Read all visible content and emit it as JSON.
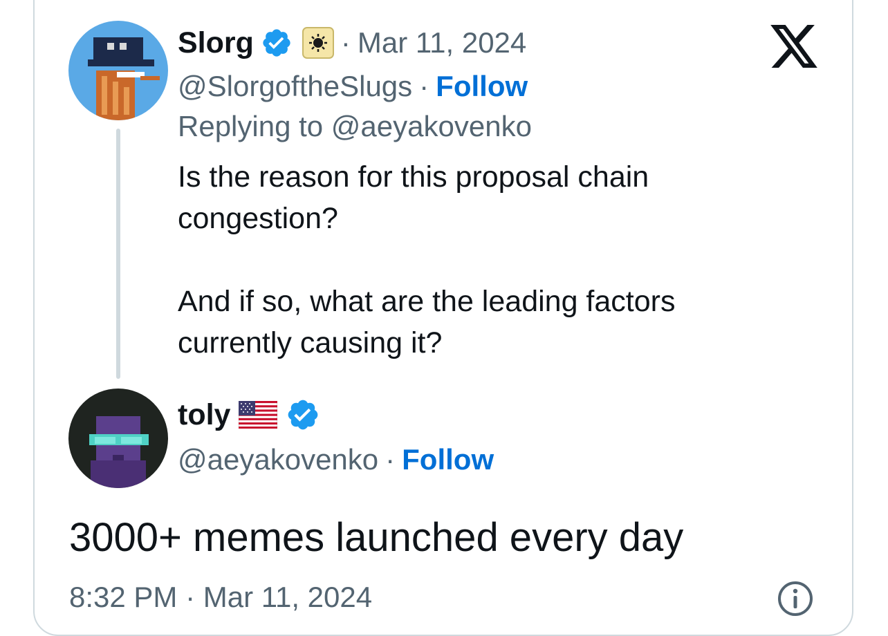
{
  "card": {
    "x_logo_icon": "x-logo-icon",
    "info_icon": "info-icon"
  },
  "reply_tweet": {
    "display_name": "Slorg",
    "verified_icon": "verified-badge-icon",
    "affiliate_icon": "affiliate-badge-icon",
    "separator": "·",
    "date": "Mar 11, 2024",
    "handle": "@SlorgoftheSlugs",
    "follow_label": "Follow",
    "replying_to": "Replying to @aeyakovenko",
    "text_line_1": "Is the reason for this proposal chain",
    "text_line_2": "congestion?",
    "text_line_3": "And if so, what are the leading factors",
    "text_line_4": "currently causing it?"
  },
  "main_tweet": {
    "display_name": "toly",
    "flag_icon": "us-flag-icon",
    "verified_icon": "verified-badge-icon",
    "handle": "@aeyakovenko",
    "separator": "·",
    "follow_label": "Follow",
    "text": "3000+ memes launched every day",
    "timestamp": "8:32 PM · Mar 11, 2024"
  },
  "colors": {
    "accent": "#006fd6",
    "verified": "#1d9bf0",
    "muted": "#536471",
    "border": "#cfd9de",
    "text": "#0f1419"
  }
}
